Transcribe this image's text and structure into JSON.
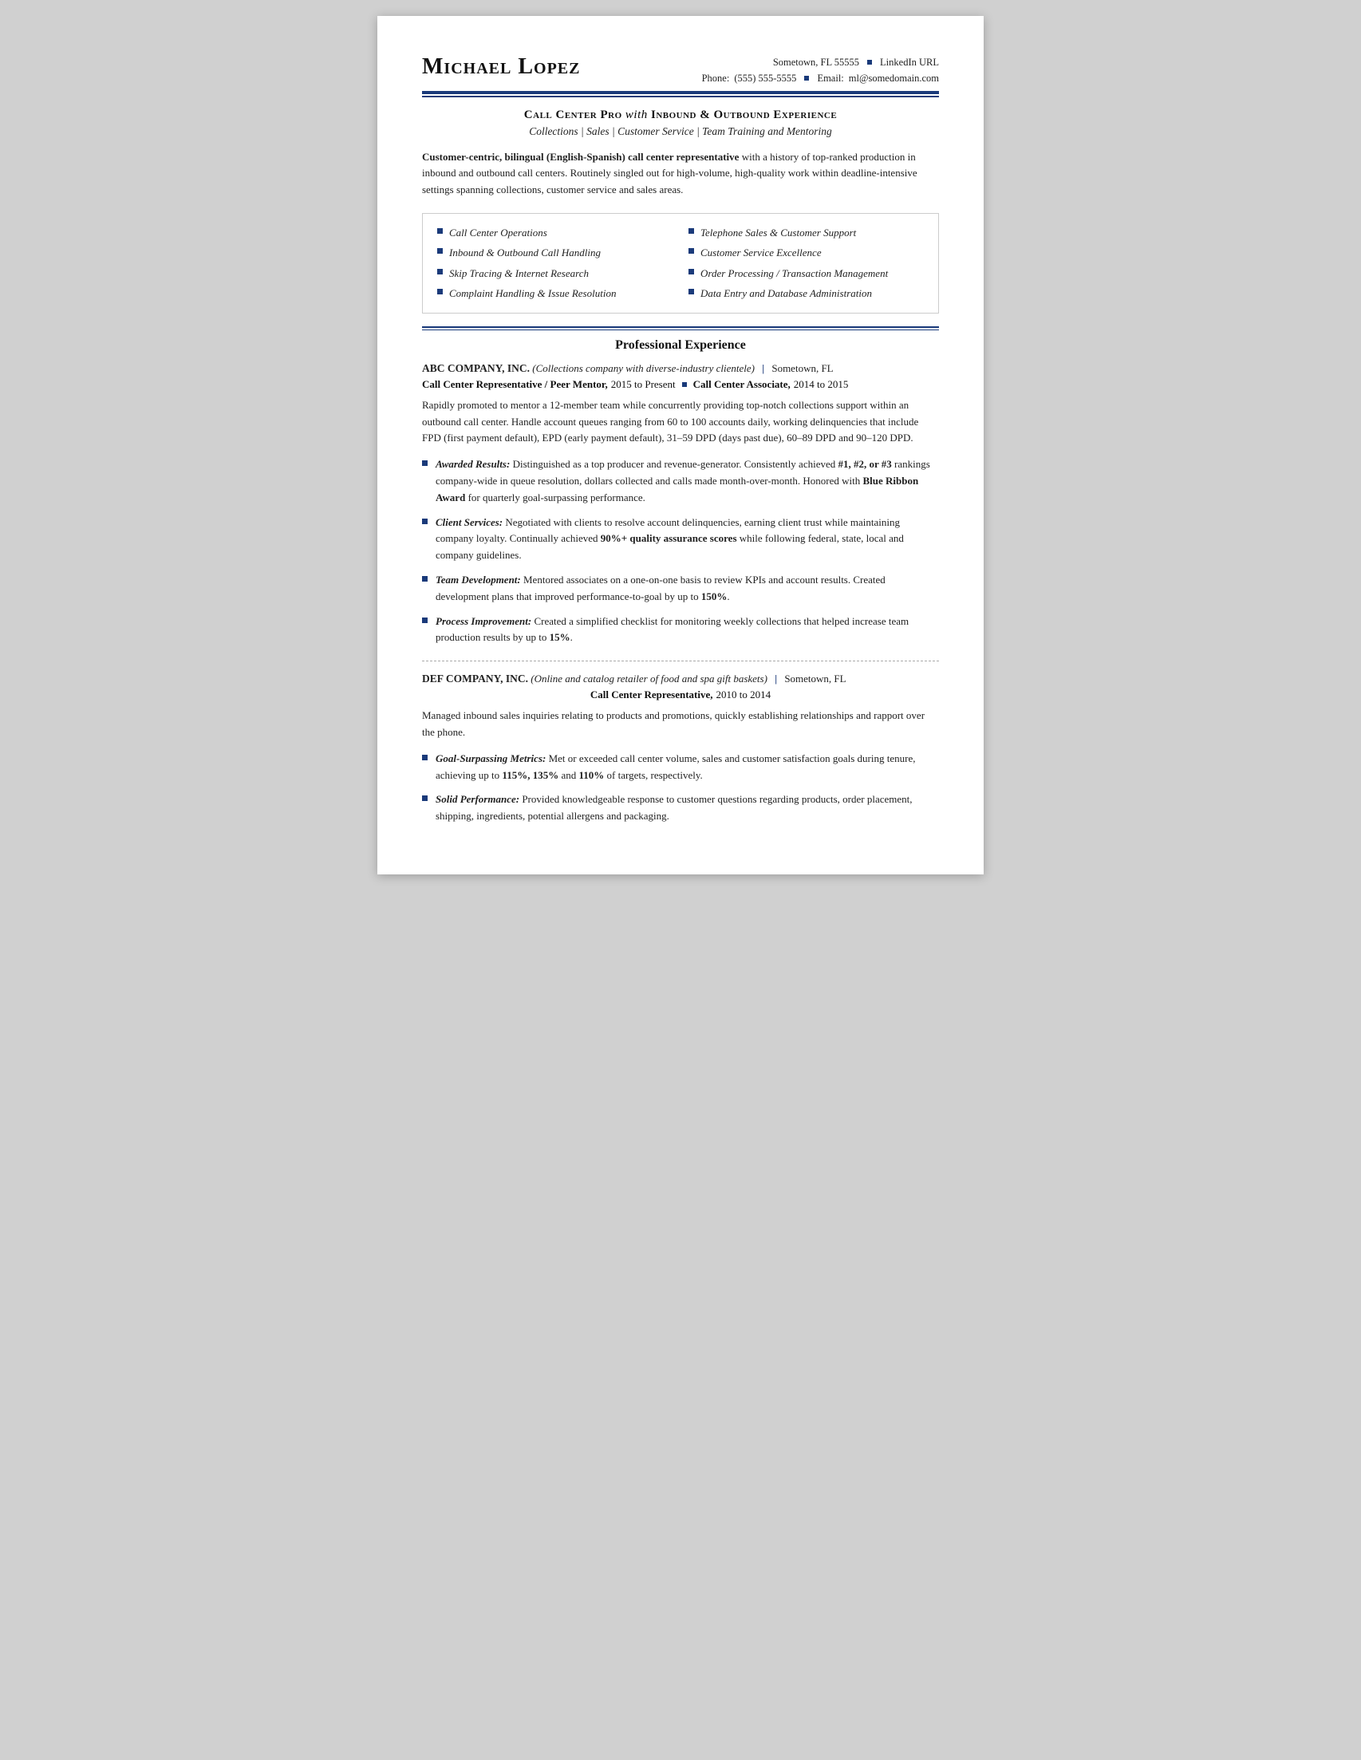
{
  "header": {
    "name": "Michael Lopez",
    "location": "Sometown, FL 55555",
    "linkedin": "LinkedIn URL",
    "phone_label": "Phone:",
    "phone": "(555) 555-5555",
    "email_label": "Email:",
    "email": "ml@somedomain.com"
  },
  "title": {
    "part1": "Call Center Pro",
    "with": "with",
    "part2": "Inbound & Outbound Experience"
  },
  "subtitle": "Collections | Sales | Customer Service | Team Training and Mentoring",
  "summary": {
    "bold_part": "Customer-centric, bilingual (English-Spanish) call center representative",
    "rest": " with a history of top-ranked production in inbound and outbound call centers. Routinely singled out for high-volume, high-quality work within deadline-intensive settings spanning collections, customer service and sales areas."
  },
  "skills": [
    "Call Center Operations",
    "Telephone Sales & Customer Support",
    "Inbound & Outbound Call Handling",
    "Customer Service Excellence",
    "Skip Tracing & Internet Research",
    "Order Processing / Transaction Management",
    "Complaint Handling & Issue Resolution",
    "Data Entry and Database Administration"
  ],
  "sections": {
    "experience_title": "Professional Experience",
    "companies": [
      {
        "name": "ABC COMPANY, INC.",
        "desc": "(Collections company with diverse-industry clientele)",
        "location": "Sometown, FL",
        "roles": [
          {
            "title": "Call Center Representative / Peer Mentor,",
            "dates": "2015 to Present",
            "secondary_title": "Call Center Associate,",
            "secondary_dates": "2014 to 2015"
          }
        ],
        "body": "Rapidly promoted to mentor a 12-member team while concurrently providing top-notch collections support within an outbound call center. Handle account queues ranging from 60 to 100 accounts daily, working delinquencies that include FPD (first payment default), EPD (early payment default), 31–59 DPD (days past due), 60–89 DPD and 90–120 DPD.",
        "bullets": [
          {
            "label": "Awarded Results:",
            "text": " Distinguished as a top producer and revenue-generator. Consistently achieved ",
            "bold_mid": "#1, #2, or #3",
            "text2": " rankings company-wide in queue resolution, dollars collected and calls made month-over-month. Honored with ",
            "bold_end": "Blue Ribbon Award",
            "text3": " for quarterly goal-surpassing performance."
          },
          {
            "label": "Client Services:",
            "text": " Negotiated with clients to resolve account delinquencies, earning client trust while maintaining company loyalty. Continually achieved ",
            "bold_mid": "90%+ quality assurance scores",
            "text2": " while following federal, state, local and company guidelines.",
            "bold_end": "",
            "text3": ""
          },
          {
            "label": "Team Development:",
            "text": " Mentored associates on a one-on-one basis to review KPIs and account results. Created development plans that improved performance-to-goal by up to ",
            "bold_mid": "150%",
            "text2": ".",
            "bold_end": "",
            "text3": ""
          },
          {
            "label": "Process Improvement:",
            "text": " Created a simplified checklist for monitoring weekly collections that helped increase team production results by up to ",
            "bold_mid": "15%",
            "text2": ".",
            "bold_end": "",
            "text3": ""
          }
        ]
      },
      {
        "name": "DEF COMPANY, INC.",
        "desc": "(Online and catalog retailer of food and spa gift baskets)",
        "location": "Sometown, FL",
        "roles": [
          {
            "title": "Call Center Representative,",
            "dates": "2010 to 2014",
            "secondary_title": "",
            "secondary_dates": ""
          }
        ],
        "body": "Managed inbound sales inquiries relating to products and promotions, quickly establishing relationships and rapport over the phone.",
        "bullets": [
          {
            "label": "Goal-Surpassing Metrics:",
            "text": " Met or exceeded call center volume, sales and customer satisfaction goals during tenure, achieving up to ",
            "bold_mid": "115%, 135%",
            "text2": " and ",
            "bold_end": "110%",
            "text3": " of targets, respectively."
          },
          {
            "label": "Solid Performance:",
            "text": " Provided knowledgeable response to customer questions regarding products, order placement, shipping, ingredients, potential allergens and packaging.",
            "bold_mid": "",
            "text2": "",
            "bold_end": "",
            "text3": ""
          }
        ]
      }
    ]
  }
}
